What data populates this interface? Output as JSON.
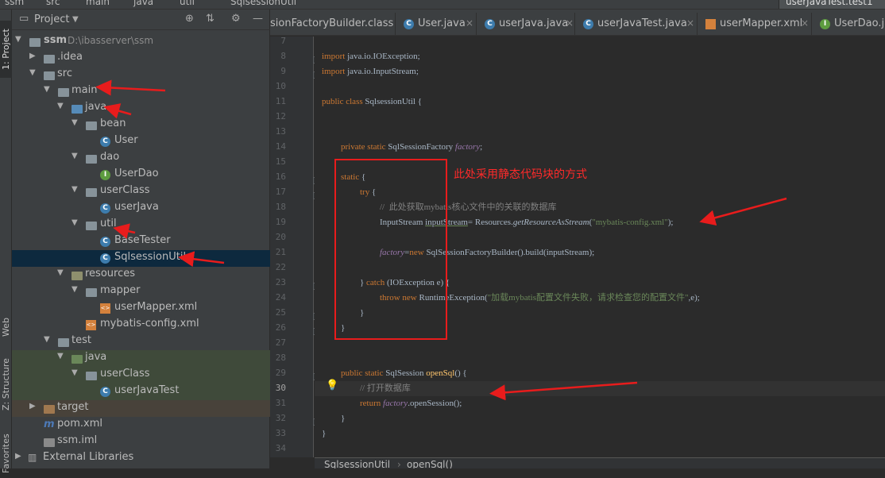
{
  "breadcrumb": [
    "ssm",
    "src",
    "main",
    "java",
    "util",
    "SqlsessionUtil"
  ],
  "top_tab": "userJavaTest.test1",
  "side_tabs": {
    "project": "1: Project",
    "web": "Web",
    "structure": "Z: Structure",
    "favorites": "Favorites"
  },
  "panel": {
    "title": "Project",
    "dropdown_icon": "chevron-down-icon",
    "icons": [
      "target-icon",
      "collapse-icon",
      "gear-icon",
      "hide-icon"
    ]
  },
  "tree": [
    {
      "label": "ssm",
      "path": "D:\\ibasserver\\ssm",
      "expanded": true
    },
    {
      "label": ".idea",
      "expanded": false
    },
    {
      "label": "src",
      "expanded": true
    },
    {
      "label": "main",
      "expanded": true
    },
    {
      "label": "java",
      "expanded": true
    },
    {
      "label": "bean",
      "expanded": true
    },
    {
      "label": "User"
    },
    {
      "label": "dao",
      "expanded": true
    },
    {
      "label": "UserDao"
    },
    {
      "label": "userClass",
      "expanded": true
    },
    {
      "label": "userJava"
    },
    {
      "label": "util",
      "expanded": true
    },
    {
      "label": "BaseTester"
    },
    {
      "label": "SqlsessionUtil",
      "selected": true
    },
    {
      "label": "resources",
      "expanded": true
    },
    {
      "label": "mapper",
      "expanded": true
    },
    {
      "label": "userMapper.xml"
    },
    {
      "label": "mybatis-config.xml"
    },
    {
      "label": "test",
      "expanded": true
    },
    {
      "label": "java",
      "expanded": true
    },
    {
      "label": "userClass",
      "expanded": true
    },
    {
      "label": "userJavaTest"
    },
    {
      "label": "target",
      "expanded": false
    },
    {
      "label": "pom.xml"
    },
    {
      "label": "ssm.iml"
    },
    {
      "label": "External Libraries",
      "expanded": false
    }
  ],
  "editor_tabs": [
    {
      "label": "sionFactoryBuilder.class"
    },
    {
      "label": "User.java"
    },
    {
      "label": "userJava.java"
    },
    {
      "label": "userJavaTest.java"
    },
    {
      "label": "userMapper.xml"
    },
    {
      "label": "UserDao.ja"
    }
  ],
  "line_numbers": [
    "7",
    "8",
    "9",
    "10",
    "11",
    "12",
    "13",
    "14",
    "15",
    "16",
    "17",
    "18",
    "19",
    "20",
    "21",
    "22",
    "23",
    "24",
    "25",
    "26",
    "27",
    "28",
    "29",
    "30",
    "31",
    "32",
    "33",
    "34"
  ],
  "current_line": "30",
  "code": {
    "l8": [
      "import",
      " java.io.IOException;"
    ],
    "l9": [
      "import",
      " java.io.InputStream;"
    ],
    "l11": [
      "public class",
      " SqlsessionUtil {"
    ],
    "l14": [
      "private static",
      " SqlSessionFactory ",
      "factory",
      ";"
    ],
    "l16": [
      "static",
      " {"
    ],
    "l17": [
      "try",
      " {"
    ],
    "l18": "//  此处获取mybatis核心文件中的关联的数据库",
    "l19": [
      "InputStream ",
      "inputStream",
      "= Resources.",
      "getResourceAsStream",
      "(",
      "\"mybatis-config.xml\"",
      ");"
    ],
    "l21": [
      "factory",
      "=",
      "new",
      " SqlSessionFactoryBuilder().build(inputStream);"
    ],
    "l23": [
      "} ",
      "catch",
      " (IOException e) {"
    ],
    "l24": [
      "throw new",
      " RuntimeException(",
      "\"加载mybatis配置文件失败，请求检查您的配置文件\"",
      ",e);"
    ],
    "l25": "}",
    "l26": "}",
    "l29": [
      "public",
      " ",
      "static",
      " SqlSession ",
      "openSql",
      "() {"
    ],
    "l30": "// 打开数据库",
    "l31": [
      "return",
      " ",
      "factory",
      ".openSession();"
    ],
    "l32": "}",
    "l33": "}"
  },
  "status": {
    "class": "SqlsessionUtil",
    "method": "openSql()"
  },
  "annotation": "此处采用静态代码块的方式",
  "colors": {
    "annotation": "#ff2a2a",
    "keyword": "#cc7832",
    "field": "#9876aa",
    "string": "#6a8759",
    "comment": "#808080",
    "method": "#ffc66d"
  }
}
